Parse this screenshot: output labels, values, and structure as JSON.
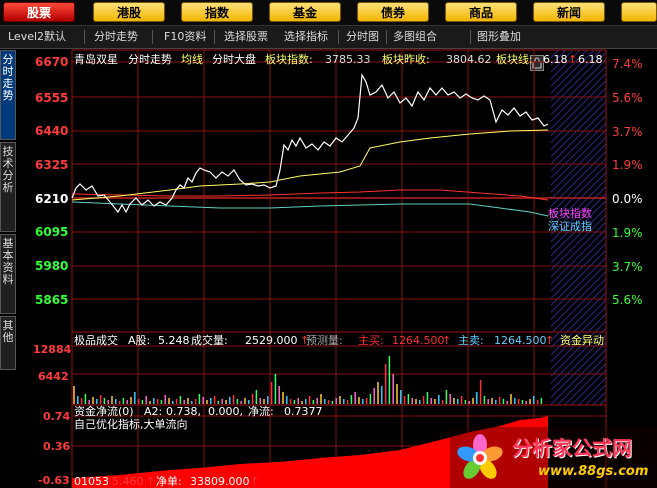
{
  "nav": {
    "items": [
      {
        "label": "股票",
        "active": true
      },
      {
        "label": "港股",
        "active": false
      },
      {
        "label": "指数",
        "active": false
      },
      {
        "label": "基金",
        "active": false
      },
      {
        "label": "债券",
        "active": false
      },
      {
        "label": "商品",
        "active": false
      },
      {
        "label": "新闻",
        "active": false
      },
      {
        "label": "",
        "active": false
      }
    ]
  },
  "toolbar": {
    "level2": "Level2默认",
    "fenshi": "分时走势",
    "f10": "F10资料",
    "select_stock": "选择股票",
    "select_indicator": "选择指标",
    "fenshitu": "分时图",
    "multi": "多图组合",
    "overlay": "图形叠加",
    "lock_icon": "lock-icon"
  },
  "side_tabs": [
    "分时走势",
    "技术分析",
    "基本资料",
    "其他"
  ],
  "header": {
    "stock_name": "青岛双星",
    "chart_name": "分时走势",
    "avg_line": "均线",
    "market": "分时大盘",
    "board_index_label": "板块指数:",
    "board_index_value": "3785.33",
    "board_prev_label": "板块昨收:",
    "board_prev_value": "3804.62",
    "board_line_label": "板块线:",
    "board_line_value": "6.18",
    "board_line_value2": "6.18"
  },
  "price_axis": [
    "6670",
    "6555",
    "6440",
    "6325",
    "6210",
    "6095",
    "5980",
    "5865"
  ],
  "pct_axis": [
    "7.4%",
    "5.6%",
    "3.7%",
    "1.9%",
    "0.0%",
    "1.9%",
    "3.7%",
    "5.6%"
  ],
  "legend": {
    "board_index": "板块指数",
    "szse_index": "深证成指"
  },
  "volume": {
    "title": "极品成交",
    "a_label": "A股:",
    "a_value": "5.248",
    "vol_label": "成交量:",
    "vol_value": "2529.000",
    "forecast_label": "预测量:",
    "main_buy_label": "主买:",
    "main_buy_value": "1264.500",
    "main_sell_label": "主卖:",
    "main_sell_value": "1264.500",
    "capital_alert": "资金异动",
    "axis": [
      "12884",
      "6442"
    ]
  },
  "flow": {
    "title": "资金净流(0)",
    "a2_label": "A2:",
    "a2_value": "0.738,",
    "zero": "0.000,",
    "net_label": "净流:",
    "net_value": "0.7377",
    "subtitle": "自己优化指标,大单流向",
    "axis": [
      "0.74",
      "0.36",
      "-0.63"
    ]
  },
  "bottom": {
    "code": "01053",
    "price": "5.460",
    "net_label": "净单:",
    "net_value": "33809.000"
  },
  "watermark": {
    "title": "分析家公式网",
    "url": "www.88gs.com"
  },
  "colors": {
    "price_up": "#ff3b3b",
    "price_down": "#33ff33",
    "grid": "#8a1010",
    "avg_line": "#ffff66"
  }
}
